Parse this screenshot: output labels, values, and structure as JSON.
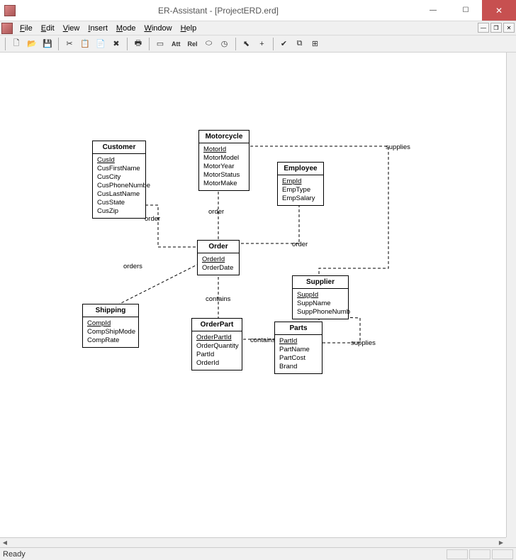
{
  "window": {
    "title": "ER-Assistant - [ProjectERD.erd]",
    "controls": {
      "min": "—",
      "max": "☐",
      "close": "✕"
    }
  },
  "menu": {
    "items": [
      "File",
      "Edit",
      "View",
      "Insert",
      "Mode",
      "Window",
      "Help"
    ],
    "mdi": {
      "min": "—",
      "max": "❐",
      "close": "✕"
    }
  },
  "toolbar": {
    "new": "🗋",
    "open": "📂",
    "save": "💾",
    "cut": "✂",
    "copy": "📋",
    "paste": "📄",
    "delete": "✖",
    "print": "🖶",
    "rect": "▭",
    "att": "Att",
    "rel": "Rel",
    "oval": "⬭",
    "clock": "◷",
    "pointer": "⬉",
    "plus": "+",
    "check": "✔",
    "align": "⧉",
    "grid": "⊞"
  },
  "entities": {
    "customer": {
      "name": "Customer",
      "attrs": [
        "CusId",
        "CusFirstName",
        "CusCity",
        "CusPhoneNumbe",
        "CusLastName",
        "CusState",
        "CusZip"
      ],
      "pk": [
        0
      ]
    },
    "motorcycle": {
      "name": "Motorcycle",
      "attrs": [
        "MotorId",
        "MotorModel",
        "MotorYear",
        "MotorStatus",
        "MotorMake"
      ],
      "pk": [
        0
      ]
    },
    "employee": {
      "name": "Employee",
      "attrs": [
        "EmpId",
        "EmpType",
        "EmpSalary"
      ],
      "pk": [
        0
      ]
    },
    "order": {
      "name": "Order",
      "attrs": [
        "OrderId",
        "OrderDate"
      ],
      "pk": [
        0
      ]
    },
    "shipping": {
      "name": "Shipping",
      "attrs": [
        "CompId",
        "CompShipMode",
        "CompRate"
      ],
      "pk": [
        0
      ]
    },
    "orderpart": {
      "name": "OrderPart",
      "attrs": [
        "OrderPartId",
        "OrderQuantity",
        "PartId",
        "OrderId"
      ],
      "pk": [
        0
      ]
    },
    "parts": {
      "name": "Parts",
      "attrs": [
        "PartId",
        "PartName",
        "PartCost",
        "Brand"
      ],
      "pk": [
        0
      ]
    },
    "supplier": {
      "name": "Supplier",
      "attrs": [
        "SuppId",
        "SuppName",
        "SuppPhoneNumb"
      ],
      "pk": [
        0
      ]
    }
  },
  "relationships": {
    "cust_order": "order",
    "motor_order": "order",
    "emp_order": "order",
    "ship_order": "orders",
    "order_orderpart": "contains",
    "orderpart_parts": "contains",
    "parts_supplier": "supplies",
    "motor_supplier": "supplies"
  },
  "status": {
    "text": "Ready"
  }
}
